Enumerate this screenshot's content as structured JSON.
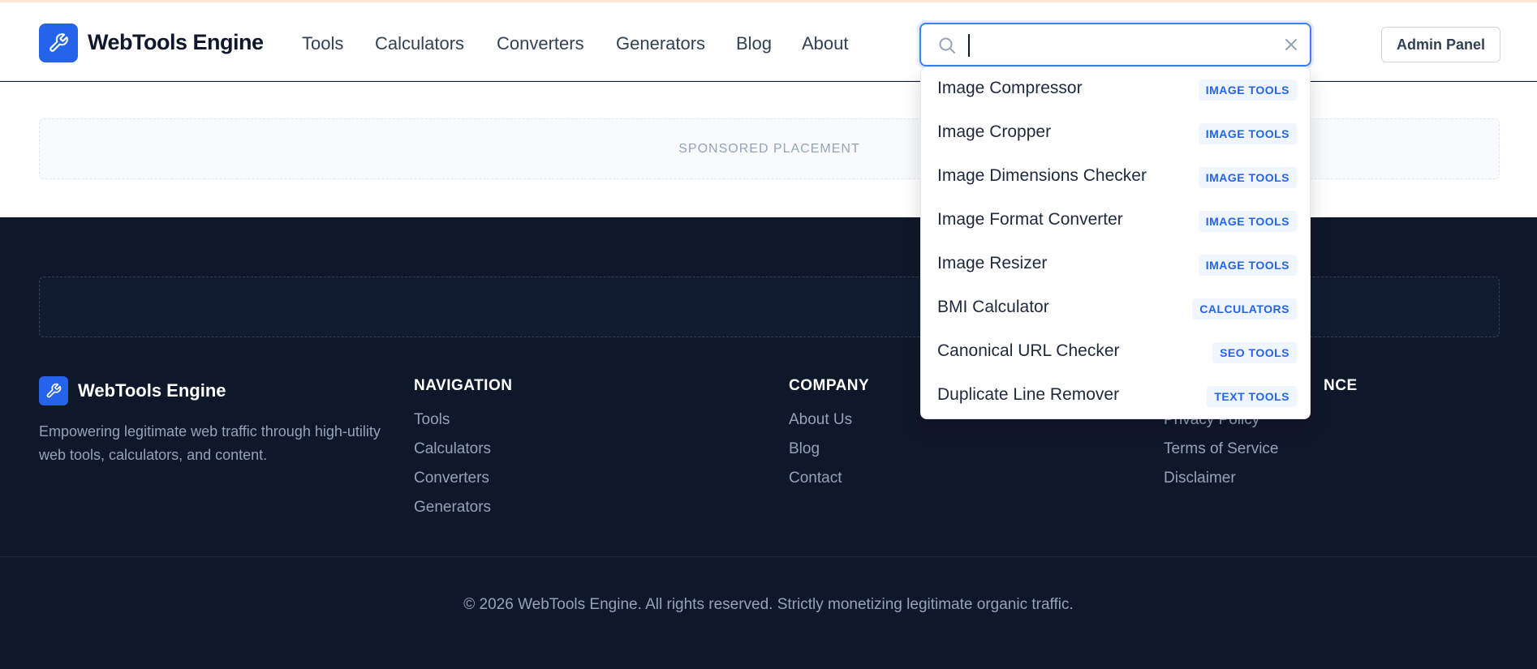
{
  "brand": {
    "name": "WebTools Engine",
    "accent": "#2563eb"
  },
  "nav": [
    "Tools",
    "Calculators",
    "Converters",
    "Generators",
    "Blog",
    "About"
  ],
  "search": {
    "value": "",
    "placeholder": ""
  },
  "header": {
    "admin_label": "Admin Panel"
  },
  "ads": {
    "sponsored_label": "SPONSORED PLACEMENT"
  },
  "dropdown": {
    "items": [
      {
        "label": "Image Compressor",
        "badge": "IMAGE TOOLS"
      },
      {
        "label": "Image Cropper",
        "badge": "IMAGE TOOLS"
      },
      {
        "label": "Image Dimensions Checker",
        "badge": "IMAGE TOOLS"
      },
      {
        "label": "Image Format Converter",
        "badge": "IMAGE TOOLS"
      },
      {
        "label": "Image Resizer",
        "badge": "IMAGE TOOLS"
      },
      {
        "label": "BMI Calculator",
        "badge": "CALCULATORS"
      },
      {
        "label": "Canonical URL Checker",
        "badge": "SEO TOOLS"
      },
      {
        "label": "Duplicate Line Remover",
        "badge": "TEXT TOOLS"
      }
    ]
  },
  "footer": {
    "brand": "WebTools Engine",
    "description": "Empowering legitimate web traffic through high-utility web tools, calculators, and content.",
    "navigation": {
      "heading": "NAVIGATION",
      "links": [
        "Tools",
        "Calculators",
        "Converters",
        "Generators"
      ]
    },
    "company": {
      "heading": "COMPANY",
      "links": [
        "About Us",
        "Blog",
        "Contact"
      ]
    },
    "compliance": {
      "heading_visible": "NCE",
      "links": [
        "Privacy Policy",
        "Terms of Service",
        "Disclaimer"
      ]
    },
    "copyright": "© 2026 WebTools Engine. All rights reserved. Strictly monetizing legitimate organic traffic."
  }
}
